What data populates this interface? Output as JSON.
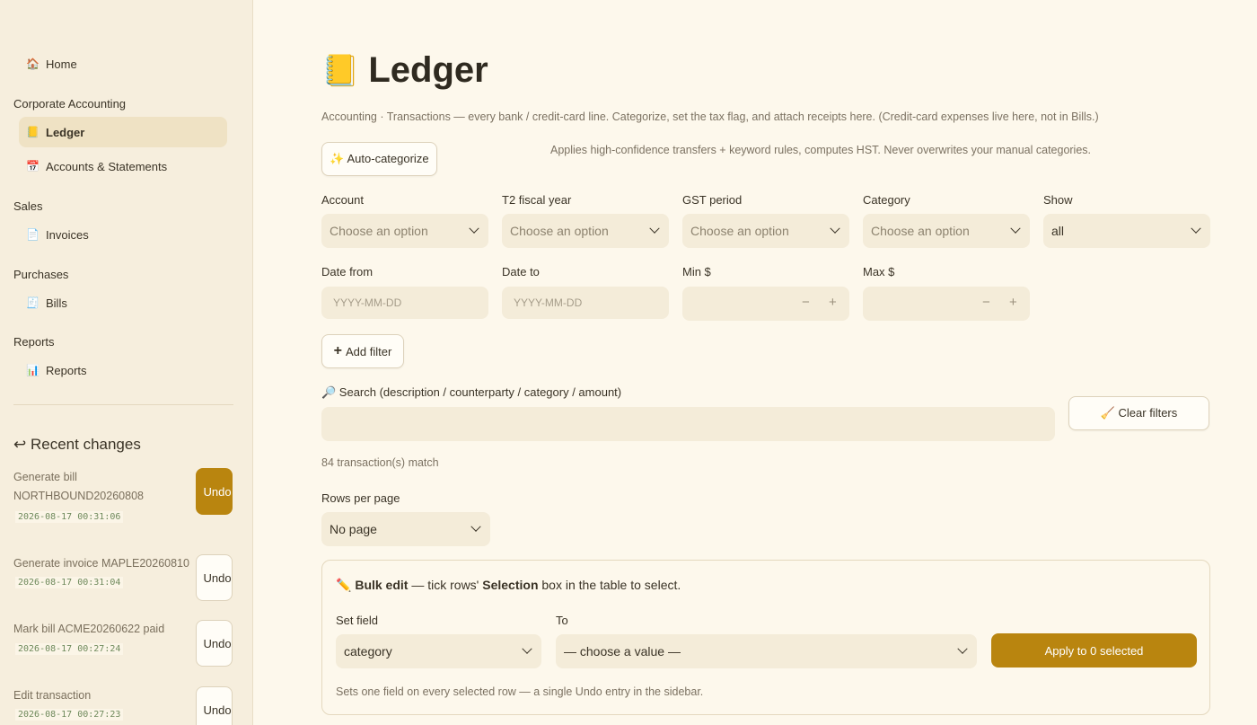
{
  "sidebar": {
    "home": "Home",
    "sections": [
      {
        "title": "Corporate Accounting",
        "items": [
          "Ledger",
          "Accounts & Statements"
        ]
      },
      {
        "title": "Sales",
        "items": [
          "Invoices"
        ]
      },
      {
        "title": "Purchases",
        "items": [
          "Bills"
        ]
      },
      {
        "title": "Reports",
        "items": [
          "Reports"
        ]
      }
    ],
    "recent_title": "Recent changes",
    "undo_label": "Undo",
    "recent": [
      {
        "label": "Generate bill NORTHBOUND20260808",
        "time": "2026-08-17 00:31:06"
      },
      {
        "label": "Generate invoice MAPLE20260810",
        "time": "2026-08-17 00:31:04"
      },
      {
        "label": "Mark bill ACME20260622 paid",
        "time": "2026-08-17 00:27:24"
      },
      {
        "label": "Edit transaction",
        "time": "2026-08-17 00:27:23"
      }
    ]
  },
  "page": {
    "title": "Ledger",
    "caption": "Accounting · Transactions — every bank / credit-card line. Categorize, set the tax flag, and attach receipts here. (Credit-card expenses live here, not in Bills.)",
    "auto_categorize": "✨ Auto-categorize",
    "auto_hint": "Applies high-confidence transfers + keyword rules, computes HST. Never overwrites your manual categories."
  },
  "filters": {
    "account": {
      "label": "Account",
      "value": "Choose an option"
    },
    "fiscal_year": {
      "label": "T2 fiscal year",
      "value": "Choose an option"
    },
    "gst_period": {
      "label": "GST period",
      "value": "Choose an option"
    },
    "category": {
      "label": "Category",
      "value": "Choose an option"
    },
    "show": {
      "label": "Show",
      "value": "all"
    },
    "date_from": {
      "label": "Date from",
      "placeholder": "YYYY-MM-DD"
    },
    "date_to": {
      "label": "Date to",
      "placeholder": "YYYY-MM-DD"
    },
    "min": {
      "label": "Min $"
    },
    "max": {
      "label": "Max $"
    },
    "add_filter": "Add filter",
    "search_label": "🔎 Search (description / counterparty / category / amount)",
    "clear_filters": "🧹 Clear filters"
  },
  "results": {
    "match_text": "84 transaction(s) match",
    "rows_per_page_label": "Rows per page",
    "rows_per_page_value": "No page"
  },
  "bulk": {
    "intro_bold1": "Bulk edit",
    "intro_mid": " — tick rows' ",
    "intro_bold2": "Selection",
    "intro_end": " box in the table to select.",
    "set_field_label": "Set field",
    "set_field_value": "category",
    "to_label": "To",
    "to_value": "— choose a value —",
    "apply": "Apply to 0 selected",
    "note": "Sets one field on every selected row — a single Undo entry in the sidebar."
  }
}
